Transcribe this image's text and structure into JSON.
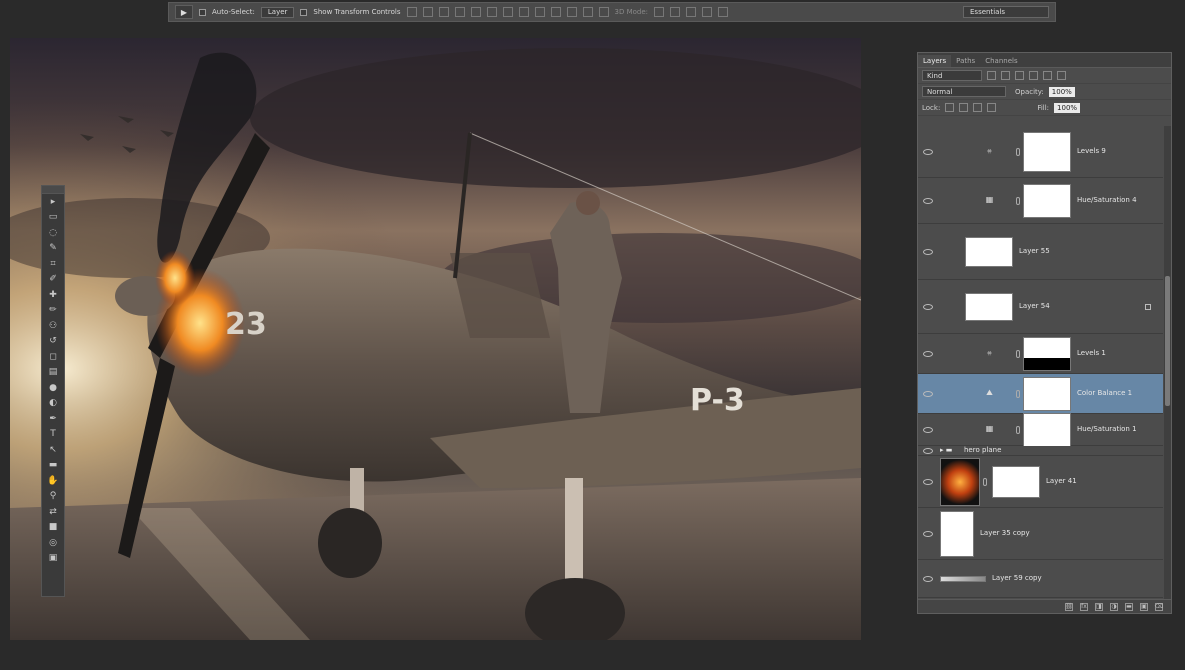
{
  "options_bar": {
    "tool_glyph": "▶",
    "auto_select_label": "Auto-Select:",
    "auto_select_target": "Layer",
    "transform_controls_label": "Show Transform Controls",
    "mode_label": "3D Mode:",
    "workspace": "Essentials"
  },
  "canvas": {
    "plane_marking_left": "23",
    "plane_marking_right": "P-3"
  },
  "toolbox": {
    "tools": [
      "move-tool",
      "marquee-tool",
      "lasso-tool",
      "quick-select-tool",
      "crop-tool",
      "eyedropper-tool",
      "healing-brush-tool",
      "brush-tool",
      "clone-stamp-tool",
      "history-brush-tool",
      "eraser-tool",
      "gradient-tool",
      "blur-tool",
      "dodge-tool",
      "pen-tool",
      "type-tool",
      "path-select-tool",
      "shape-tool",
      "hand-tool",
      "zoom-tool",
      "swap-colors",
      "color-swatches",
      "quick-mask",
      "screen-mode"
    ]
  },
  "layers_panel": {
    "tabs": [
      "Layers",
      "Paths",
      "Channels"
    ],
    "active_tab": "Layers",
    "filter_kind": "Kind",
    "blend_mode": "Normal",
    "opacity_label": "Opacity:",
    "opacity_value": "100%",
    "lock_label": "Lock:",
    "fill_label": "Fill:",
    "fill_value": "100%",
    "layers": [
      {
        "name": "Levels 9",
        "kind": "levels-adjustment",
        "active": false
      },
      {
        "name": "Hue/Saturation 4",
        "kind": "hue-saturation-adjustment",
        "active": false
      },
      {
        "name": "Layer 55",
        "kind": "pixel-layer",
        "active": false
      },
      {
        "name": "Layer 54",
        "kind": "pixel-layer",
        "active": false,
        "locked": true
      },
      {
        "name": "Levels 1",
        "kind": "levels-adjustment",
        "active": false
      },
      {
        "name": "Color Balance 1",
        "kind": "color-balance-adjustment",
        "active": true
      },
      {
        "name": "Hue/Saturation 1",
        "kind": "hue-saturation-adjustment",
        "active": false
      },
      {
        "name": "hero plane",
        "kind": "group",
        "active": false
      },
      {
        "name": "Layer 41",
        "kind": "pixel-layer-with-mask",
        "active": false
      },
      {
        "name": "Layer 35 copy",
        "kind": "pixel-layer",
        "active": false
      },
      {
        "name": "Layer 59 copy",
        "kind": "pixel-layer",
        "active": false
      }
    ],
    "footer_icons": [
      "link-icon",
      "fx-icon",
      "mask-icon",
      "adjustment-icon",
      "folder-icon",
      "new-layer-icon",
      "trash-icon"
    ]
  },
  "colors": {
    "panel_bg": "#4c4c4c",
    "selected_layer": "#6787a6",
    "app_bg": "#2a2a2a"
  }
}
